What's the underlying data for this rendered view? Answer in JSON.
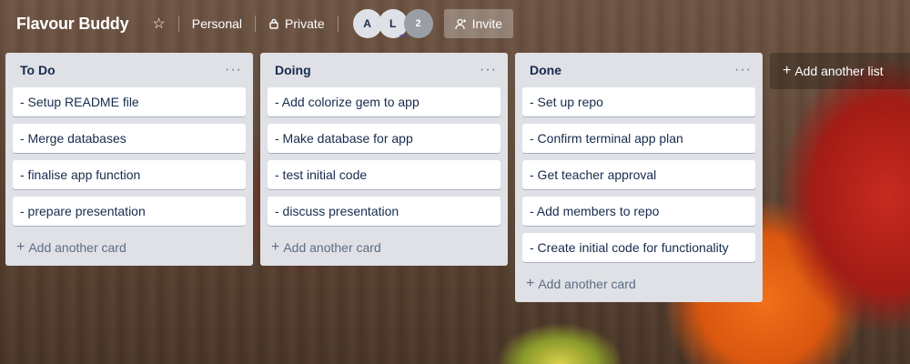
{
  "header": {
    "board_title": "Flavour Buddy",
    "star_icon": "star-icon",
    "team_label": "Personal",
    "visibility_label": "Private",
    "members": [
      "A",
      "L"
    ],
    "member_count": "2",
    "invite_label": "Invite"
  },
  "lists": [
    {
      "title": "To Do",
      "cards": [
        "- Setup README file",
        "- Merge databases",
        "- finalise app function",
        "- prepare presentation"
      ],
      "add_card": "Add another card"
    },
    {
      "title": "Doing",
      "cards": [
        "- Add colorize gem to app",
        "- Make database for app",
        "- test initial code",
        "- discuss presentation"
      ],
      "add_card": "Add another card"
    },
    {
      "title": "Done",
      "cards": [
        "- Set up repo",
        "- Confirm terminal app plan",
        "- Get teacher approval",
        "- Add members to repo",
        "- Create initial code for functionality"
      ],
      "add_card": "Add another card"
    }
  ],
  "add_list_label": "Add another list",
  "colors": {
    "list_bg": "#dfe1e6",
    "card_text": "#172b4d",
    "muted": "#5e6c84"
  }
}
